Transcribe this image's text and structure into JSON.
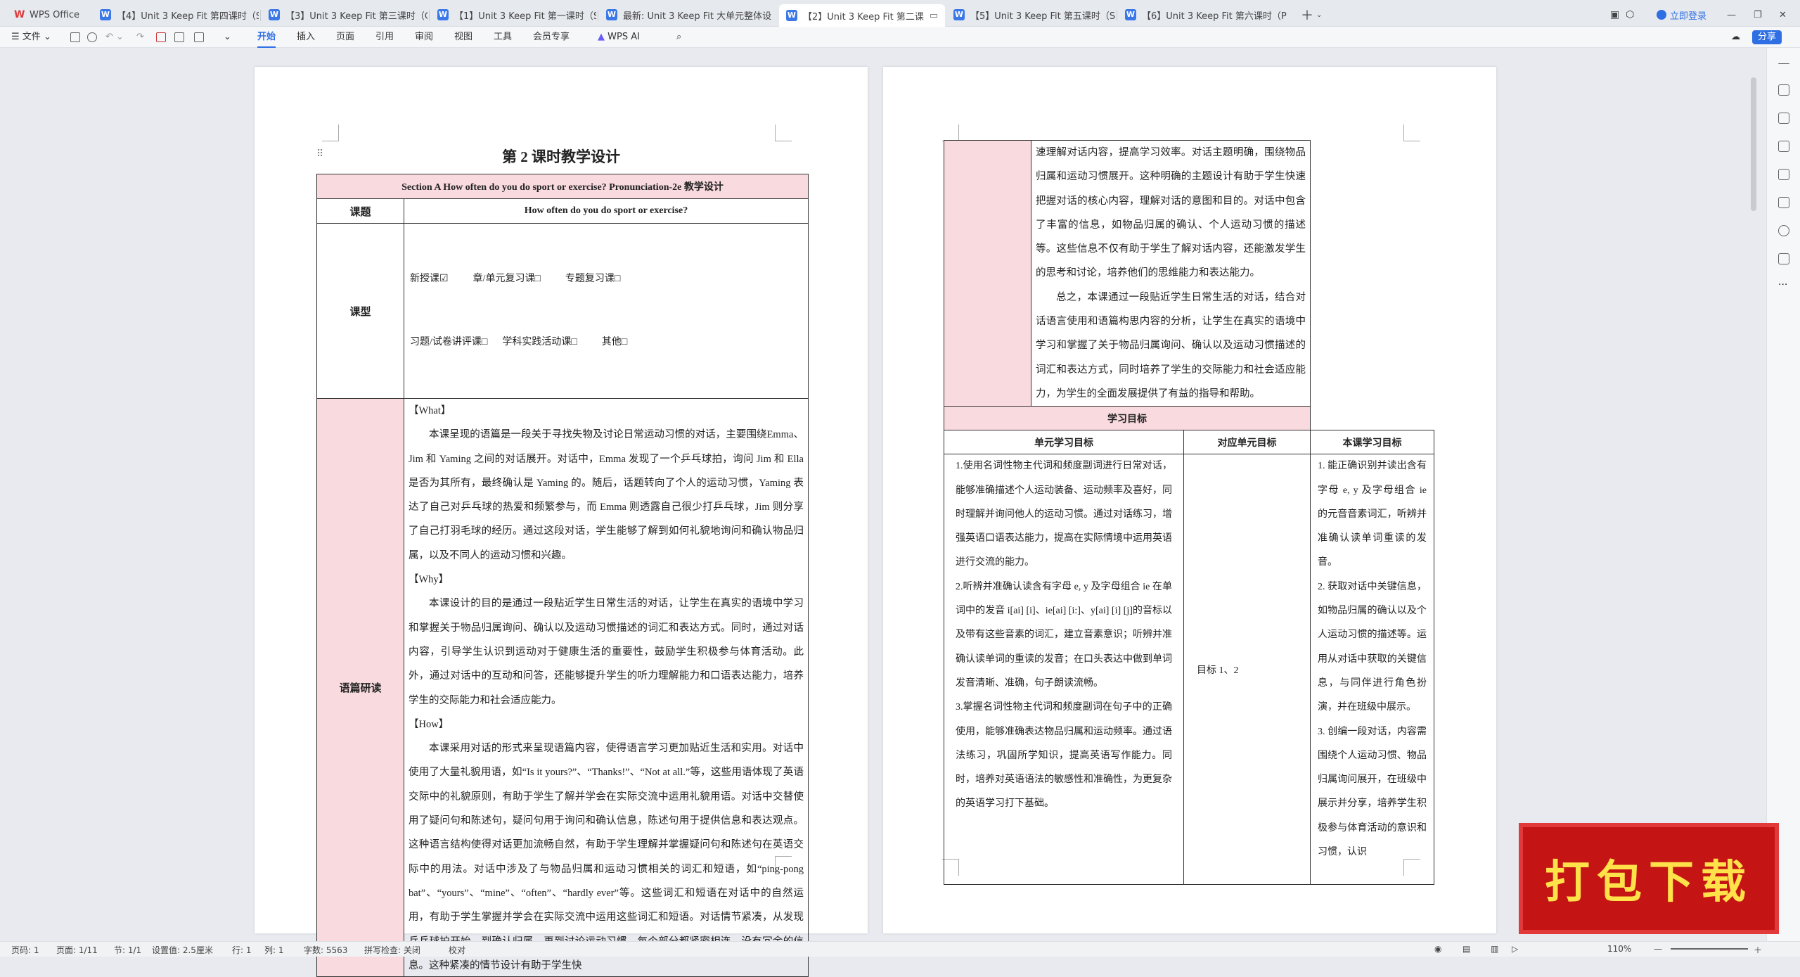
{
  "tabs": [
    {
      "label": "WPS Office",
      "type": "home"
    },
    {
      "label": "【4】Unit 3 Keep Fit 第四课时（Se",
      "type": "doc"
    },
    {
      "label": "【3】Unit 3 Keep Fit 第三课时（Gra",
      "type": "doc"
    },
    {
      "label": "【1】Unit 3 Keep Fit 第一课时（Se",
      "type": "doc"
    },
    {
      "label": "最新: Unit 3 Keep Fit 大单元整体设",
      "type": "doc"
    },
    {
      "label": "【2】Unit 3 Keep Fit 第二课",
      "type": "doc",
      "active": true
    },
    {
      "label": "【5】Unit 3 Keep Fit 第五课时（Se",
      "type": "doc"
    },
    {
      "label": "【6】Unit 3 Keep Fit 第六课时（Pro",
      "type": "doc"
    }
  ],
  "window": {
    "login": "立即登录",
    "share": "分享"
  },
  "menu": {
    "file": "文件",
    "items": [
      "开始",
      "插入",
      "页面",
      "引用",
      "审阅",
      "视图",
      "工具",
      "会员专享"
    ],
    "ai": "WPS AI"
  },
  "page1": {
    "title": "第 2 课时教学设计",
    "header": "Section A How often do you do sport or exercise? Pronunciation-2e 教学设计",
    "topic_label": "课题",
    "topic": "How often do you do sport or exercise?",
    "type_label": "课型",
    "type_line1": "新授课☑          章/单元复习课□          专题复习课□",
    "type_line2": "习题/试卷讲评课□      学科实践活动课□          其他□",
    "analysis_label": "语篇研读",
    "paras": [
      {
        "h": true,
        "t": "【What】"
      },
      {
        "t": "本课呈现的语篇是一段关于寻找失物及讨论日常运动习惯的对话，主要围绕Emma、Jim 和 Yaming 之间的对话展开。对话中，Emma 发现了一个乒乓球拍，询问 Jim 和 Ella 是否为其所有，最终确认是 Yaming 的。随后，话题转向了个人的运动习惯，Yaming 表达了自己对乒乓球的热爱和频繁参与，而 Emma 则透露自己很少打乒乓球，Jim 则分享了自己打羽毛球的经历。通过这段对话，学生能够了解到如何礼貌地询问和确认物品归属，以及不同人的运动习惯和兴趣。"
      },
      {
        "h": true,
        "t": "【Why】"
      },
      {
        "t": "本课设计的目的是通过一段贴近学生日常生活的对话，让学生在真实的语境中学习和掌握关于物品归属询问、确认以及运动习惯描述的词汇和表达方式。同时，通过对话内容，引导学生认识到运动对于健康生活的重要性，鼓励学生积极参与体育活动。此外，通过对话中的互动和问答，还能够提升学生的听力理解能力和口语表达能力，培养学生的交际能力和社会适应能力。"
      },
      {
        "h": true,
        "t": "【How】"
      },
      {
        "t": "本课采用对话的形式来呈现语篇内容，使得语言学习更加贴近生活和实用。对话中使用了大量礼貌用语，如“Is it yours?”、“Thanks!”、“Not at all.”等，这些用语体现了英语交际中的礼貌原则，有助于学生了解并学会在实际交流中运用礼貌用语。对话中交替使用了疑问句和陈述句，疑问句用于询问和确认信息，陈述句用于提供信息和表达观点。这种语言结构使得对话更加流畅自然，有助于学生理解并掌握疑问句和陈述句在英语交际中的用法。对话中涉及了与物品归属和运动习惯相关的词汇和短语，如“ping-pong bat”、“yours”、“mine”、“often”、“hardly ever”等。这些词汇和短语在对话中的自然运用，有助于学生掌握并学会在实际交流中运用这些词汇和短语。对话情节紧凑，从发现乒乓球拍开始，到确认归属，再到讨论运动习惯，每个部分都紧密相连，没有冗余的信息。这种紧凑的情节设计有助于学生快"
      }
    ]
  },
  "page2": {
    "cont_paras": [
      {
        "t": "速理解对话内容，提高学习效率。对话主题明确，围绕物品归属和运动习惯展开。这种明确的主题设计有助于学生快速把握对话的核心内容，理解对话的意图和目的。对话中包含了丰富的信息，如物品归属的确认、个人运动习惯的描述等。这些信息不仅有助于学生了解对话内容，还能激发学生的思考和讨论，培养他们的思维能力和表达能力。",
        "noindent": true
      },
      {
        "t": "总之，本课通过一段贴近学生日常生活的对话，结合对话语言使用和语篇构思内容的分析，让学生在真实的语境中学习和掌握了关于物品归属询问、确认以及运动习惯描述的词汇和表达方式，同时培养了学生的交际能力和社会适应能力，为学生的全面发展提供了有益的指导和帮助。"
      }
    ],
    "objectives_label": "学习目标",
    "col1": "单元学习目标",
    "col2": "对应单元目标",
    "col3": "本课学习目标",
    "unit_goals": [
      "1.使用名词性物主代词和频度副词进行日常对话，能够准确描述个人运动装备、运动频率及喜好，同时理解并询问他人的运动习惯。通过对话练习，增强英语口语表达能力，提高在实际情境中运用英语进行交流的能力。",
      "2.听辨并准确认读含有字母 e, y 及字母组合 ie 在单词中的发音 i[ai] [i]、ie[ai] [i:]、y[ai] [i] [j]的音标以及带有这些音素的词汇，建立音素意识；听辨并准确认读单词的重读的发音；在口头表达中做到单词发音清晰、准确，句子朗读流畅。",
      "3.掌握名词性物主代词和频度副词在句子中的正确使用，能够准确表达物品归属和运动频率。通过语法练习，巩固所学知识，提高英语写作能力。同时，培养对英语语法的敏感性和准确性，为更复杂的英语学习打下基础。"
    ],
    "mapped": "目标 1、2",
    "lesson_goals": [
      "1. 能正确识别并读出含有字母 e, y 及字母组合 ie 的元音音素词汇，听辨并准确认读单词重读的发音。",
      "2. 获取对话中关键信息，如物品归属的确认以及个人运动习惯的描述等。运用从对话中获取的关键信息，与同伴进行角色扮演，并在班级中展示。",
      "3. 创编一段对话，内容需围绕个人运动习惯、物品归属询问展开，在班级中展示并分享，培养学生积极参与体育活动的意识和习惯，认识"
    ]
  },
  "promo": "打包下载",
  "status": {
    "page": "页码: 1",
    "pages": "页面: 1/11",
    "section": "节: 1/1",
    "setting": "设置值: 2.5厘米",
    "row": "行: 1",
    "col": "列: 1",
    "words": "字数: 5563",
    "spell": "拼写检查: 关闭",
    "proof": "校对",
    "zoom": "110%"
  }
}
